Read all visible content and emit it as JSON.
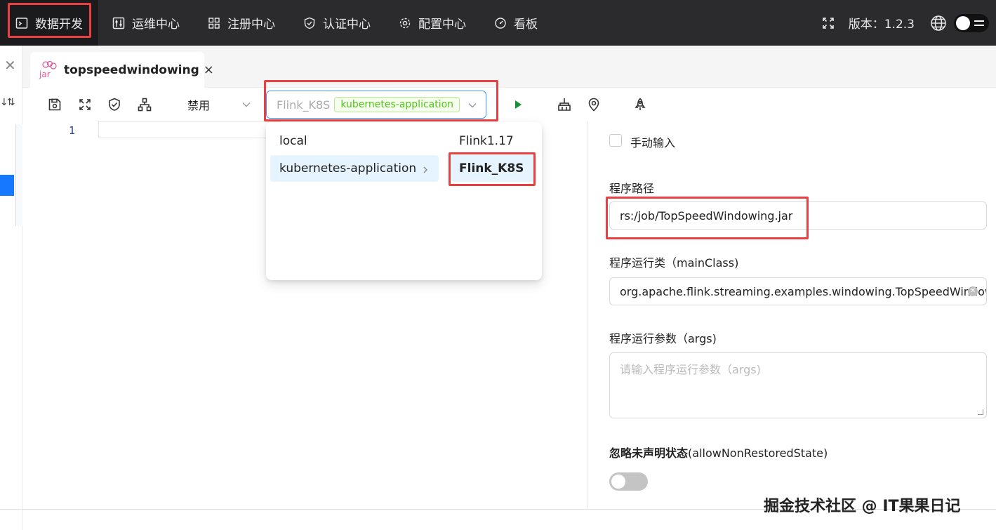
{
  "nav": {
    "items": [
      {
        "label": "数据开发",
        "icon": "terminal-icon"
      },
      {
        "label": "运维中心",
        "icon": "sliders-icon"
      },
      {
        "label": "注册中心",
        "icon": "grid-icon"
      },
      {
        "label": "认证中心",
        "icon": "shield-check-icon"
      },
      {
        "label": "配置中心",
        "icon": "gear-icon"
      },
      {
        "label": "看板",
        "icon": "dashboard-icon"
      }
    ],
    "version": "版本：1.2.3"
  },
  "tab": {
    "icon_text": "jar",
    "label": "topspeedwindowing",
    "close": "×"
  },
  "toolbar": {
    "mode_select": "禁用",
    "cluster_select": "Flink_K8S",
    "cluster_tag": "kubernetes-application"
  },
  "editor": {
    "line_number": "1"
  },
  "dropdown": {
    "types": [
      "local",
      "kubernetes-application"
    ],
    "clusters": [
      "Flink1.17",
      "Flink_K8S"
    ]
  },
  "form": {
    "manual_input_label": "手动输入",
    "program_path_label": "程序路径",
    "program_path_value": "rs:/job/TopSpeedWindowing.jar",
    "main_class_label": "程序运行类（mainClass)",
    "main_class_value": "org.apache.flink.streaming.examples.windowing.TopSpeedWindowing",
    "args_label": "程序运行参数（args)",
    "args_placeholder": "请输入程序运行参数（args)",
    "allow_label_strong": "忽略未声明状态",
    "allow_label_rest": "(allowNonRestoredState)"
  },
  "watermark": "掘金技术社区 @ IT果果日记",
  "colors": {
    "nav_bg": "#2b2b2e",
    "highlight_box": "#e84040",
    "accent": "#1677ff",
    "run_green": "#1a8f3a",
    "tag_green": "#52c41a"
  }
}
